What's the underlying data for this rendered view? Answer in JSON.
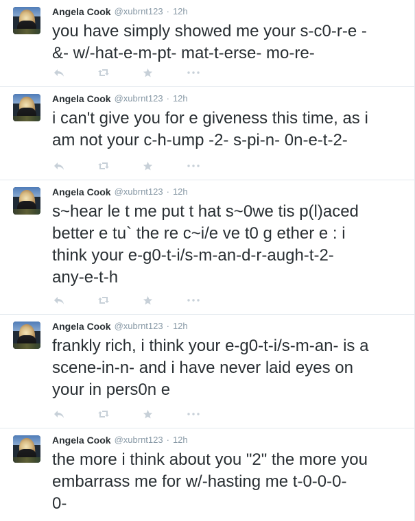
{
  "colors": {
    "text": "#292f33",
    "meta": "#8899a6",
    "divider": "#e1e8ed",
    "icon": "#c7d0d8"
  },
  "icons": {
    "reply": "reply-icon",
    "retweet": "retweet-icon",
    "favorite": "star-icon",
    "more": "more-icon"
  },
  "tweets": [
    {
      "author": "Angela Cook",
      "handle": "@xubrnt123",
      "dot": "·",
      "time": "12h",
      "text": "you have simply showed me your s-c0-r-e -\n&- w/-hat-e-m-pt- mat-t-erse- mo-re-"
    },
    {
      "author": "Angela Cook",
      "handle": "@xubrnt123",
      "dot": "·",
      "time": "12h",
      "text": "i can't give you for e giveness this time, as i\nam not your c-h-ump -2- s-pi-n- 0n-e-t-2-"
    },
    {
      "author": "Angela Cook",
      "handle": "@xubrnt123",
      "dot": "·",
      "time": "12h",
      "text": "s~hear le t me put t hat s~0we tis p(l)aced\nbetter e tu` the re c~i/e ve t0 g ether e : i\nthink your e-g0-t-i/s-m-an-d-r-augh-t-2-\nany-e-t-h"
    },
    {
      "author": "Angela Cook",
      "handle": "@xubrnt123",
      "dot": "·",
      "time": "12h",
      "text": "frankly rich, i think your e-g0-t-i/s-m-an- is a\nscene-in-n- and i have never laid eyes on\nyour in pers0n e"
    },
    {
      "author": "Angela Cook",
      "handle": "@xubrnt123",
      "dot": "·",
      "time": "12h",
      "text": "the more i think about you \"2\" the more you\nembarrass me for w/-hasting me t-0-0-0-\n0-"
    }
  ]
}
